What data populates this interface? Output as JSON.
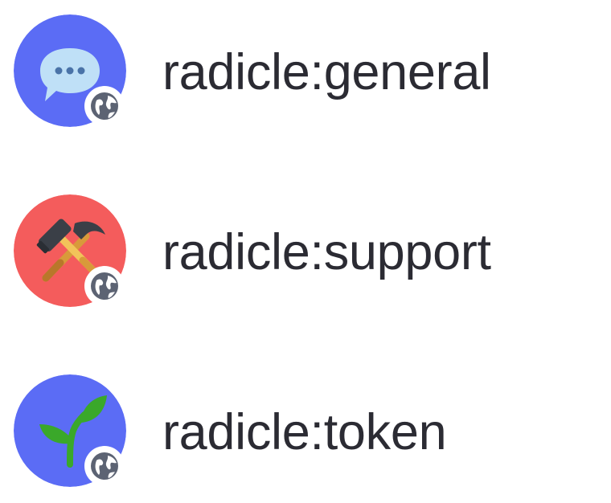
{
  "channels": [
    {
      "name": "radicle:general",
      "avatar_bg": "#5b6cf5",
      "icon": "speech-bubble-icon",
      "visibility_icon": "globe-icon"
    },
    {
      "name": "radicle:support",
      "avatar_bg": "#f45c5c",
      "icon": "hammer-and-pick-icon",
      "visibility_icon": "globe-icon"
    },
    {
      "name": "radicle:token",
      "avatar_bg": "#5b6cf5",
      "icon": "seedling-icon",
      "visibility_icon": "globe-icon"
    }
  ],
  "colors": {
    "text": "#2b2b33",
    "badge_bg": "#ffffff",
    "globe": "#5c6373"
  }
}
